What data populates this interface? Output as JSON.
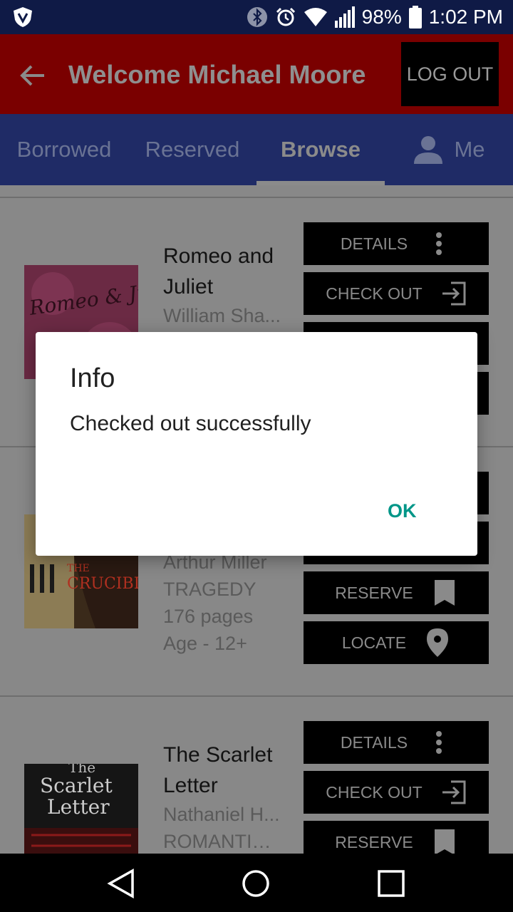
{
  "status_bar": {
    "battery": "98%",
    "time": "1:02 PM",
    "icons": [
      "vpn-shield-icon",
      "bluetooth-icon",
      "alarm-icon",
      "wifi-icon",
      "signal-icon",
      "battery-icon"
    ]
  },
  "app_bar": {
    "title": "Welcome Michael Moore",
    "logout_label": "LOG OUT"
  },
  "tabs": [
    {
      "label": "Borrowed",
      "active": false
    },
    {
      "label": "Reserved",
      "active": false
    },
    {
      "label": "Browse",
      "active": true
    },
    {
      "label": "Me",
      "active": false
    }
  ],
  "books": [
    {
      "title": "Romeo and Juliet",
      "author": "William Sha...",
      "buttons": [
        "DETAILS",
        "CHECK OUT"
      ]
    },
    {
      "author": "Arthur Miller",
      "genre": "TRAGEDY",
      "pages": "176 pages",
      "age": "Age - 12+",
      "buttons": [
        "RESERVE",
        "LOCATE"
      ]
    },
    {
      "title": "The Scarlet Letter",
      "author": "Nathaniel H...",
      "genre": "ROMANTICI...",
      "buttons": [
        "DETAILS",
        "CHECK OUT",
        "RESERVE"
      ]
    }
  ],
  "covers": {
    "romeo": "Romeo & Juliet",
    "crucible_a": "THE",
    "crucible_b": "CRUCIBLE",
    "scarlet_a": "The",
    "scarlet_b": "Scarlet",
    "scarlet_c": "Letter"
  },
  "dialog": {
    "title": "Info",
    "message": "Checked out successfully",
    "ok_label": "OK"
  },
  "colors": {
    "status_bar": "#0f1a46",
    "app_bar": "#7a0000",
    "tab_bar": "#1f2b66",
    "dialog_accent": "#009688"
  }
}
